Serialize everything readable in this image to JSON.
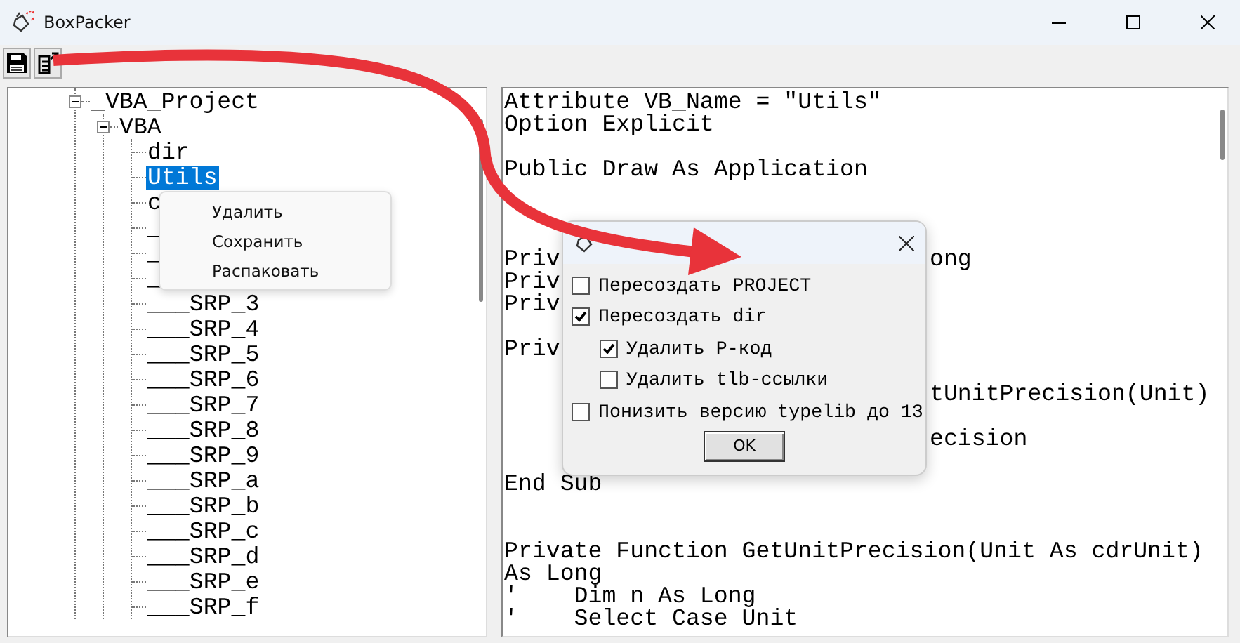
{
  "window": {
    "title": "BoxPacker"
  },
  "tree": [
    {
      "label": "_VBA_Project",
      "expanded": true,
      "selected": false,
      "children": [
        {
          "label": "VBA",
          "expanded": true,
          "selected": false,
          "children": [
            {
              "label": "dir",
              "selected": false
            },
            {
              "label": "Utils",
              "selected": true
            },
            {
              "label": "c",
              "selected": false
            },
            {
              "label": "_",
              "selected": false
            },
            {
              "label": "_",
              "selected": false
            },
            {
              "label": "_",
              "selected": false
            },
            {
              "label": "___SRP_3",
              "selected": false
            },
            {
              "label": "___SRP_4",
              "selected": false
            },
            {
              "label": "___SRP_5",
              "selected": false
            },
            {
              "label": "___SRP_6",
              "selected": false
            },
            {
              "label": "___SRP_7",
              "selected": false
            },
            {
              "label": "___SRP_8",
              "selected": false
            },
            {
              "label": "___SRP_9",
              "selected": false
            },
            {
              "label": "___SRP_a",
              "selected": false
            },
            {
              "label": "___SRP_b",
              "selected": false
            },
            {
              "label": "___SRP_c",
              "selected": false
            },
            {
              "label": "___SRP_d",
              "selected": false
            },
            {
              "label": "___SRP_e",
              "selected": false
            },
            {
              "label": "___SRP_f",
              "selected": false
            }
          ]
        }
      ]
    }
  ],
  "context_menu": [
    "Удалить",
    "Сохранить",
    "Распаковать"
  ],
  "code_lines": [
    {
      "kind": "text",
      "text": "Attribute VB_Name = \"Utils\""
    },
    {
      "kind": "text",
      "text": "Option Explicit"
    },
    {
      "kind": "blank"
    },
    {
      "kind": "text",
      "text": "Public Draw As Application"
    },
    {
      "kind": "blank"
    },
    {
      "kind": "blank"
    },
    {
      "kind": "blank"
    },
    {
      "kind": "text",
      "text": "Priv",
      "tail": "ong"
    },
    {
      "kind": "text",
      "text": "Priv"
    },
    {
      "kind": "text",
      "text": "Priv"
    },
    {
      "kind": "blank"
    },
    {
      "kind": "text",
      "text": "Priv"
    },
    {
      "kind": "blank"
    },
    {
      "kind": "text",
      "tail": "tUnitPrecision(Unit)"
    },
    {
      "kind": "blank"
    },
    {
      "kind": "text",
      "tail": "ecision"
    },
    {
      "kind": "blank"
    },
    {
      "kind": "text",
      "text": "End Sub"
    },
    {
      "kind": "blank"
    },
    {
      "kind": "blank"
    },
    {
      "kind": "text",
      "text": "Private Function GetUnitPrecision(Unit As cdrUnit)"
    },
    {
      "kind": "text",
      "text": "As Long"
    },
    {
      "kind": "text",
      "text": "'    Dim n As Long"
    },
    {
      "kind": "text",
      "text": "'    Select Case Unit"
    }
  ],
  "dialog": {
    "options": [
      {
        "label": "Пересоздать PROJECT",
        "checked": false
      },
      {
        "label": "Пересоздать dir",
        "checked": true,
        "children": [
          {
            "label": "Удалить P-код",
            "checked": true
          },
          {
            "label": "Удалить tlb-ссылки",
            "checked": false
          }
        ]
      },
      {
        "label": "Понизить версию typelib до 13",
        "checked": false
      }
    ],
    "button": "OK"
  }
}
